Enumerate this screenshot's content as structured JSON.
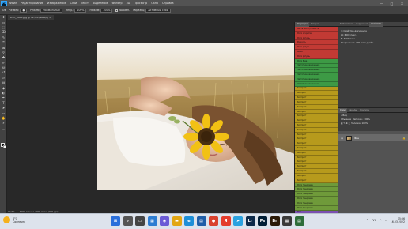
{
  "app": {
    "logo": "Ps"
  },
  "menu": [
    "Файл",
    "Редактирование",
    "Изображение",
    "Слои",
    "Текст",
    "Выделение",
    "Фильтр",
    "3D",
    "Просмотр",
    "Окно",
    "Справка"
  ],
  "window_controls": [
    "—",
    "□",
    "✕"
  ],
  "options_bar": {
    "size_label": "Размер:",
    "mode_label": "Режим:",
    "mode_value": "Нормальный",
    "opacity_label": "Непр.:",
    "opacity_value": "100%",
    "flow_label": "Нажим:",
    "flow_value": "100%",
    "align_label": "Выравн.",
    "sample_label": "Образец:",
    "sample_value": "Активный слой"
  },
  "document": {
    "tab_title": "DSC_0485.jpg @ 12,5% (RGB/8)"
  },
  "status": {
    "zoom": "12,5%",
    "info": "6000 пикс. x 4000 пикс. (300 ppi)"
  },
  "history_panel": {
    "tabs": [
      "Операции",
      "История"
    ],
    "rows": [
      {
        "label": "Кисть (Фото) Разность",
        "kb": "",
        "color": "#c23a34"
      },
      {
        "label": "Фото открытие",
        "kb": "",
        "color": "#c23a34"
      },
      {
        "label": "Фото ретушь",
        "kb": "",
        "color": "#c23a34"
      },
      {
        "label": "Резкость",
        "kb": "",
        "color": "#c23a34"
      },
      {
        "label": "Фото ретушь",
        "kb": "",
        "color": "#c23a34"
      },
      {
        "label": "Кожа",
        "kb": "",
        "color": "#c23a34"
      },
      {
        "label": "Фото ретушь",
        "kb": "",
        "color": "#c23a34"
      },
      {
        "label": "Фото база",
        "kb": "",
        "color": "#3d9a45"
      },
      {
        "label": "Частотное разложение",
        "kb": "",
        "color": "#3d9a45"
      },
      {
        "label": "Частотное разложение",
        "kb": "",
        "color": "#3d9a45"
      },
      {
        "label": "Частотное разложение",
        "kb": "",
        "color": "#3d9a45"
      },
      {
        "label": "Частотное разложение",
        "kb": "",
        "color": "#3d9a45"
      },
      {
        "label": "Частотное разложение",
        "kb": "",
        "color": "#3d9a45"
      },
      {
        "label": "Контраст",
        "kb": "",
        "color": "#b79a1c"
      },
      {
        "label": "Контраст",
        "kb": "",
        "color": "#b79a1c"
      },
      {
        "label": "Контраст",
        "kb": "",
        "color": "#b79a1c"
      },
      {
        "label": "Контраст",
        "kb": "",
        "color": "#b79a1c"
      },
      {
        "label": "Контраст",
        "kb": "",
        "color": "#b79a1c"
      },
      {
        "label": "Контраст",
        "kb": "",
        "color": "#b79a1c"
      },
      {
        "label": "Контраст",
        "kb": "",
        "color": "#b79a1c"
      },
      {
        "label": "Контраст",
        "kb": "",
        "color": "#b79a1c"
      },
      {
        "label": "Контраст",
        "kb": "",
        "color": "#b79a1c"
      },
      {
        "label": "Контраст",
        "kb": "",
        "color": "#b79a1c"
      },
      {
        "label": "Контраст",
        "kb": "",
        "color": "#b79a1c"
      },
      {
        "label": "Контраст",
        "kb": "",
        "color": "#b79a1c"
      },
      {
        "label": "Контраст",
        "kb": "",
        "color": "#b79a1c"
      },
      {
        "label": "Контраст",
        "kb": "",
        "color": "#b79a1c"
      },
      {
        "label": "Контраст",
        "kb": "",
        "color": "#b79a1c"
      },
      {
        "label": "Контраст",
        "kb": "",
        "color": "#b79a1c"
      },
      {
        "label": "Контраст",
        "kb": "",
        "color": "#b79a1c"
      },
      {
        "label": "Контраст",
        "kb": "",
        "color": "#b79a1c"
      },
      {
        "label": "Контраст",
        "kb": "",
        "color": "#b79a1c"
      },
      {
        "label": "Контраст",
        "kb": "",
        "color": "#b79a1c"
      },
      {
        "label": "Контраст",
        "kb": "",
        "color": "#b79a1c"
      },
      {
        "label": "Фото тонировка",
        "kb": "",
        "color": "#6f9a3a"
      },
      {
        "label": "Фото тонировка",
        "kb": "",
        "color": "#6f9a3a"
      },
      {
        "label": "Фото тонировка",
        "kb": "",
        "color": "#6f9a3a"
      },
      {
        "label": "Фото тонировка",
        "kb": "",
        "color": "#6f9a3a"
      },
      {
        "label": "Фото тонировка",
        "kb": "",
        "color": "#6f9a3a"
      },
      {
        "label": "Фото тонировка",
        "kb": "",
        "color": "#6f9a3a"
      },
      {
        "label": "Ночь",
        "kb": "",
        "color": "#7b4fb0"
      },
      {
        "label": "Ночь",
        "kb": "",
        "color": "#7b4fb0"
      },
      {
        "label": "Ночь",
        "kb": "",
        "color": "#7b4fb0"
      }
    ]
  },
  "right_panel": {
    "tabs": [
      "Библиотеки",
      "Коррекция",
      "Свойства"
    ],
    "properties_title": "Свойства документа",
    "rows": [
      "Ш: 6000 пикс.",
      "В: 4000 пикс.",
      "Разрешение: 300 пикс./дюйм"
    ],
    "layers_tabs": [
      "Слои",
      "Каналы",
      "Контуры"
    ],
    "layers_kind": "Вид",
    "blend_mode": "Обычные",
    "opacity_label": "Непрозр.: 100%",
    "fill_label": "Заливка: 100%",
    "layer_name": "Фон"
  },
  "taskbar": {
    "weather_temp": "4°C",
    "weather_text": "Солнечно",
    "time": "15:56",
    "date": "16.03.2022",
    "lang": "РУС",
    "apps": [
      {
        "name": "start-icon",
        "glyph": "⊞",
        "color": "#2a6fdb"
      },
      {
        "name": "search-icon",
        "glyph": "⌕",
        "color": "#555"
      },
      {
        "name": "taskview-icon",
        "glyph": "▭",
        "color": "#444"
      },
      {
        "name": "widgets-icon",
        "glyph": "▦",
        "color": "#2d7dd2"
      },
      {
        "name": "chat-icon",
        "glyph": "◉",
        "color": "#6b5bd6"
      },
      {
        "name": "explorer-icon",
        "glyph": "▬",
        "color": "#e2a614"
      },
      {
        "name": "edge-icon",
        "glyph": "e",
        "color": "#1d8fd8"
      },
      {
        "name": "store-icon",
        "glyph": "▤",
        "color": "#1f5ea8"
      },
      {
        "name": "chrome-icon",
        "glyph": "●",
        "color": "#d9412e"
      },
      {
        "name": "yandex-icon",
        "glyph": "Я",
        "color": "#e33c2d"
      },
      {
        "name": "telegram-icon",
        "glyph": "➤",
        "color": "#2aa2e0"
      },
      {
        "name": "lightroom-icon",
        "glyph": "Lr",
        "color": "#0c2a4a"
      },
      {
        "name": "photoshop-icon",
        "glyph": "Ps",
        "color": "#001e36"
      },
      {
        "name": "bridge-icon",
        "glyph": "Br",
        "color": "#2a1a08"
      },
      {
        "name": "calc-icon",
        "glyph": "▦",
        "color": "#3a3a3a"
      },
      {
        "name": "notes-icon",
        "glyph": "▤",
        "color": "#2e6d3a"
      }
    ]
  },
  "colors": {
    "app_bg": "#282828",
    "panel": "#323232",
    "history_red": "#c23a34",
    "history_green": "#3d9a45",
    "history_yellow": "#b79a1c",
    "history_purple": "#7b4fb0",
    "sunflower": "#f2c114"
  }
}
